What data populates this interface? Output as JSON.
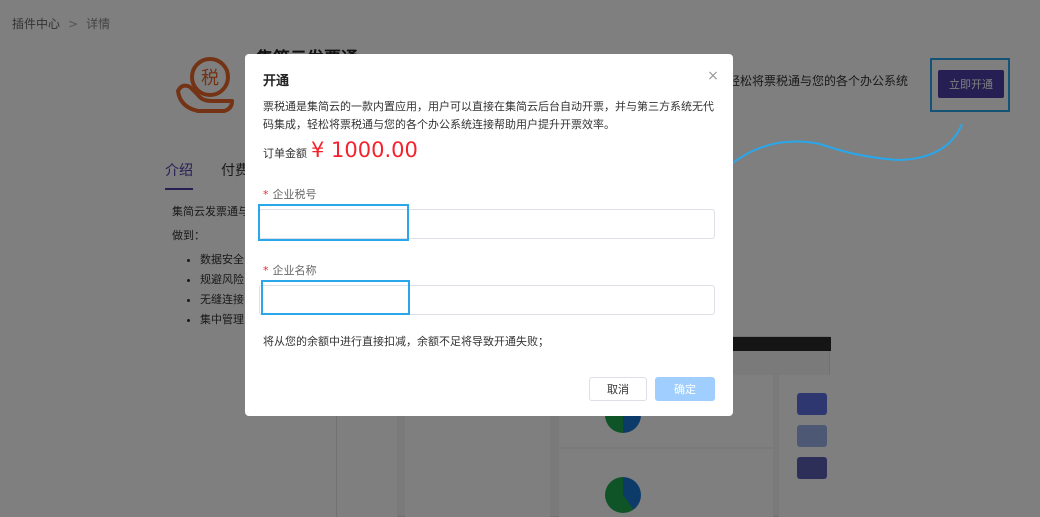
{
  "breadcrumb": {
    "root": "插件中心",
    "separator": ">",
    "current": "详情"
  },
  "plugin": {
    "title": "集简云发票通",
    "desc_right": "轻松将票税通与您的各个办公系统",
    "open_button": "立即开通",
    "logo_char": "税"
  },
  "tabs": [
    {
      "label": "介绍"
    },
    {
      "label": "付费方式"
    }
  ],
  "intro": {
    "line1": "集简云发票通与",
    "line2": "做到："
  },
  "bullets": [
    "数据安全",
    "规避风险",
    "无缝连接",
    "集中管理"
  ],
  "modal": {
    "title": "开通",
    "close": "×",
    "description": "票税通是集简云的一款内置应用，用户可以直接在集简云后台自动开票，并与第三方系统无代码集成，轻松将票税通与您的各个办公系统连接帮助用户提升开票效率。",
    "amount_label": "订单金额",
    "amount_value": "¥ 1000.00",
    "field1": {
      "label": "企业税号",
      "required": "*",
      "value": "",
      "placeholder": ""
    },
    "field2": {
      "label": "企业名称",
      "required": "*",
      "value": "",
      "placeholder": ""
    },
    "note": "将从您的余额中进行直接扣减，余额不足将导致开通失败；",
    "cancel": "取消",
    "confirm": "确定"
  },
  "colors": {
    "accent": "#4b3ea8",
    "highlight": "#29a7ea",
    "price": "#f5222d",
    "confirm_disabled": "#a0cfff",
    "logo": "#e8672a"
  }
}
